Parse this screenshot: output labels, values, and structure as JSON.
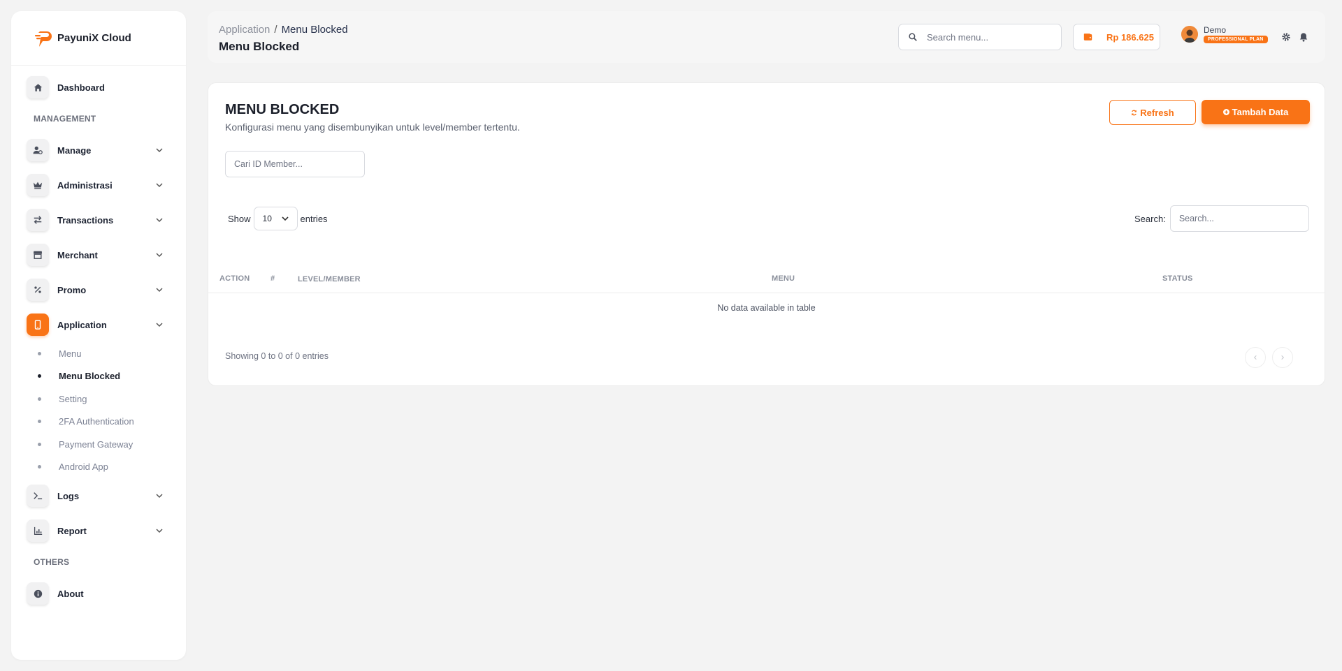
{
  "app": {
    "name": "PayuniX Cloud"
  },
  "sidebar": {
    "dashboard": "Dashboard",
    "section_management": "MANAGEMENT",
    "items": [
      {
        "label": "Manage",
        "icon": "user-gear-icon"
      },
      {
        "label": "Administrasi",
        "icon": "crown-icon"
      },
      {
        "label": "Transactions",
        "icon": "arrows-exchange-icon"
      },
      {
        "label": "Merchant",
        "icon": "store-icon"
      },
      {
        "label": "Promo",
        "icon": "percent-icon"
      },
      {
        "label": "Application",
        "icon": "mobile-icon"
      }
    ],
    "application_sub": [
      "Menu",
      "Menu Blocked",
      "Setting",
      "2FA Authentication",
      "Payment Gateway",
      "Android App"
    ],
    "items2": [
      {
        "label": "Logs",
        "icon": "terminal-icon"
      },
      {
        "label": "Report",
        "icon": "chart-icon"
      }
    ],
    "section_others": "OTHERS",
    "about": "About"
  },
  "header": {
    "breadcrumb_parent": "Application",
    "breadcrumb_separator": "/",
    "breadcrumb_current": "Menu Blocked",
    "title": "Menu Blocked",
    "search_placeholder": "Search menu...",
    "balance": "Rp 186.625",
    "user_name": "Demo",
    "plan": "PROFESSIONAL PLAN"
  },
  "card": {
    "title": "MENU BLOCKED",
    "subtitle": "Konfigurasi menu yang disembunyikan untuk level/member tertentu.",
    "refresh_label": "Refresh",
    "add_label": "Tambah Data",
    "member_placeholder": "Cari ID Member...",
    "show_label": "Show",
    "entries_value": "10",
    "entries_label": "entries",
    "search_label": "Search:",
    "search_placeholder": "Search...",
    "columns": [
      "ACTION",
      "#",
      "LEVEL/MEMBER",
      "MENU",
      "STATUS"
    ],
    "empty_text": "No data available in table",
    "info_text": "Showing 0 to 0 of 0 entries"
  },
  "colors": {
    "accent": "#f97316",
    "background": "#f3f3f3"
  }
}
